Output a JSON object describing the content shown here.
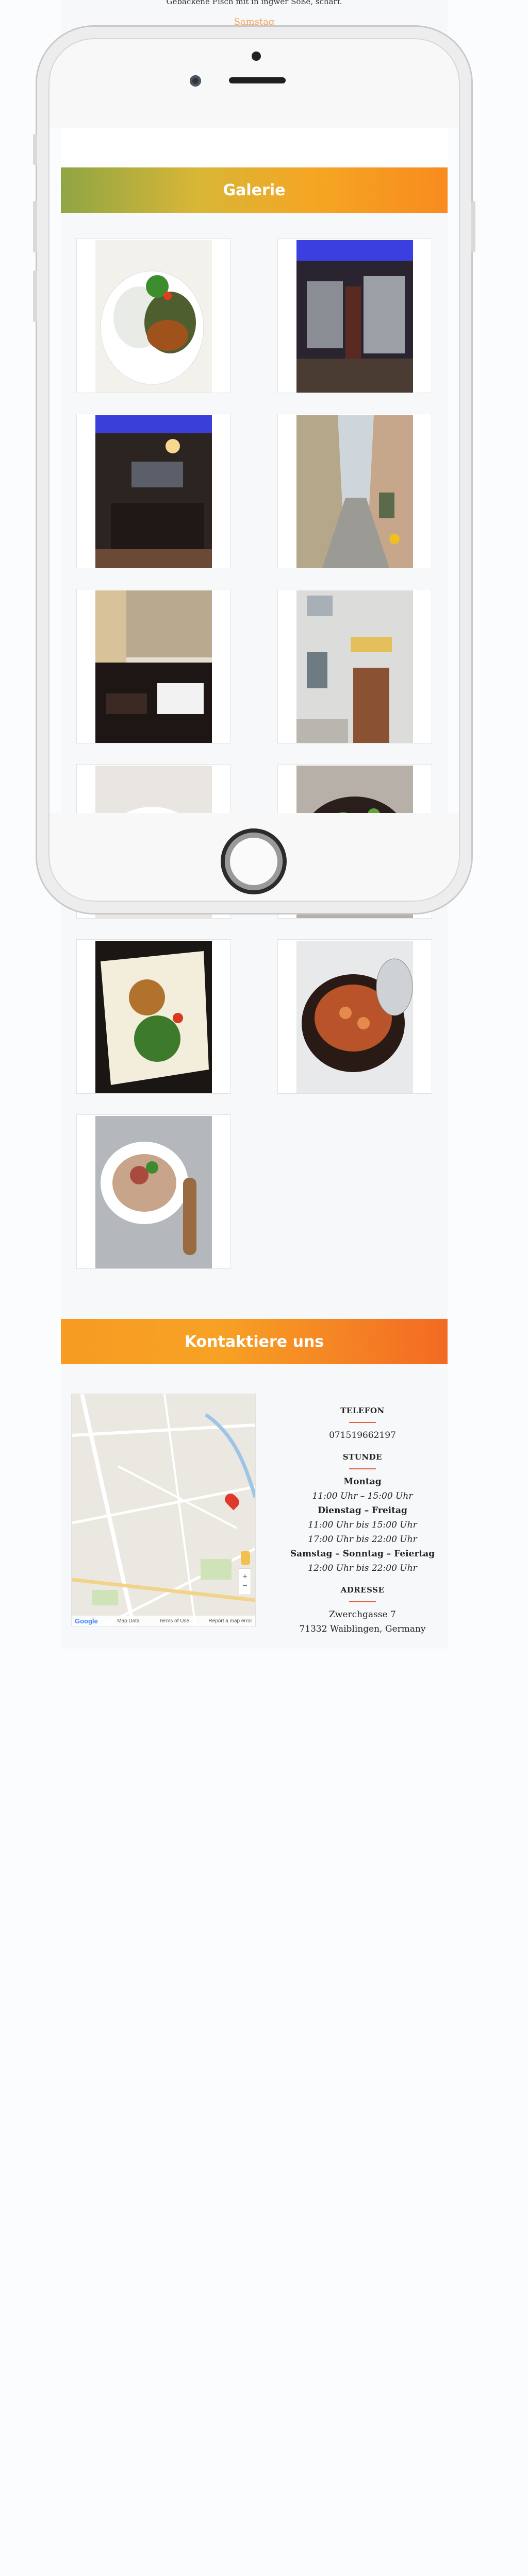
{
  "top": {
    "caption": "Gebackene Fisch mit in ingwer Soße, scharf.",
    "link": "Samstag"
  },
  "gallery": {
    "title": "Galerie",
    "items": [
      {
        "alt": "Teller mit Gemüse und Reis"
      },
      {
        "alt": "Restaurant Eingang mit blauer Beleuchtung"
      },
      {
        "alt": "Restaurant Innenraum mit Tischen"
      },
      {
        "alt": "Gasse vor dem Restaurant"
      },
      {
        "alt": "Gedeckte Tische im Gastraum"
      },
      {
        "alt": "Hausfassade mit Eingangstür"
      },
      {
        "alt": "Teller mit Speisen"
      },
      {
        "alt": "Schale mit Salat"
      },
      {
        "alt": "Teller mit Salat und Reis"
      },
      {
        "alt": "Tontopf mit Garnelen"
      },
      {
        "alt": "Suppe mit Rindfleisch und Löffel"
      }
    ]
  },
  "contact": {
    "title": "Kontaktiere uns",
    "phone_label": "TELEFON",
    "phone": "071519662197",
    "hours_label": "STUNDE",
    "hours": [
      {
        "day": "Montag",
        "times": [
          "11:00 Uhr – 15:00 Uhr"
        ]
      },
      {
        "day": "Dienstag – Freitag",
        "times": [
          "11:00 Uhr bis 15:00 Uhr",
          "17:00 Uhr bis 22:00 Uhr"
        ]
      },
      {
        "day": "Samstag – Sonntag – Feiertag",
        "times": [
          "12:00 Uhr bis 22:00 Uhr"
        ]
      }
    ],
    "address_label": "ADRESSE",
    "street": "Zwerchgasse 7",
    "city": "71332 Waiblingen, Germany",
    "map": {
      "logo": "Google",
      "footer_links": [
        "Map Data",
        "Terms of Use",
        "Report a map error"
      ],
      "zoom_in": "+",
      "zoom_out": "−"
    }
  },
  "colors": {
    "accent": "#f5a623",
    "rule": "#e06440",
    "link": "#f4a24a"
  }
}
